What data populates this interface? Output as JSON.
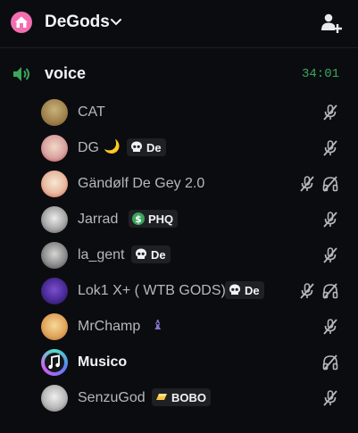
{
  "header": {
    "server_name": "DeGods",
    "icon": "house-icon",
    "invite_icon": "add-member-icon"
  },
  "channel": {
    "name": "voice",
    "timer": "34:01",
    "icon": "speaker-icon"
  },
  "users": [
    {
      "name": "CAT"
    },
    {
      "name": "DG",
      "emoji": "🌙",
      "tag": "De"
    },
    {
      "name": "Gändølf De Gey 2.0"
    },
    {
      "name": "Jarrad",
      "tag": "PHQ"
    },
    {
      "name": "la_gent",
      "tag": "De"
    },
    {
      "name": "Lok1 X+ ( WTB GODS)",
      "tag": "De"
    },
    {
      "name": "MrChamp",
      "emoji": "♝"
    },
    {
      "name": "Musico"
    },
    {
      "name": "SenzuGod",
      "tag": "BOBO"
    }
  ],
  "colors": {
    "accent_green": "#3ba55c",
    "background": "#0b0c0f",
    "muted": "#b5b8bd"
  }
}
